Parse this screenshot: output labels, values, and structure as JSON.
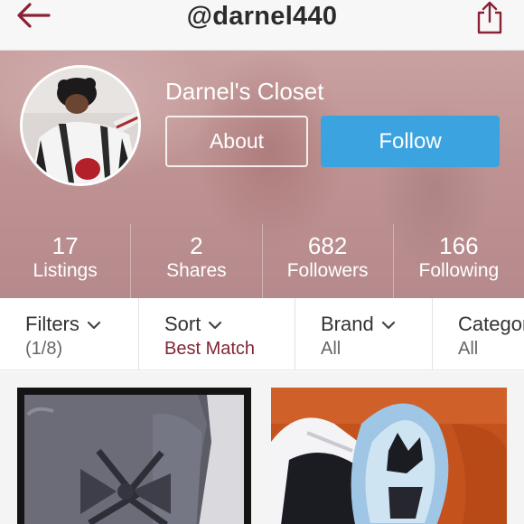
{
  "header": {
    "username": "@darnel440",
    "back_icon": "back-arrow-icon",
    "share_icon": "share-icon",
    "accent_color": "#8a2134"
  },
  "profile": {
    "closet_name": "Darnel's Closet",
    "about_label": "About",
    "follow_label": "Follow",
    "follow_color": "#3ba3e0",
    "stats": [
      {
        "value": "17",
        "label": "Listings"
      },
      {
        "value": "2",
        "label": "Shares"
      },
      {
        "value": "682",
        "label": "Followers"
      },
      {
        "value": "166",
        "label": "Following"
      }
    ]
  },
  "filters": [
    {
      "title": "Filters",
      "value": "(1/8)"
    },
    {
      "title": "Sort",
      "value": "Best Match"
    },
    {
      "title": "Brand",
      "value": "All"
    },
    {
      "title": "Category",
      "value": "All"
    }
  ],
  "listings": [
    {
      "image": "grey-boots-photo"
    },
    {
      "image": "sneakers-photo"
    }
  ]
}
